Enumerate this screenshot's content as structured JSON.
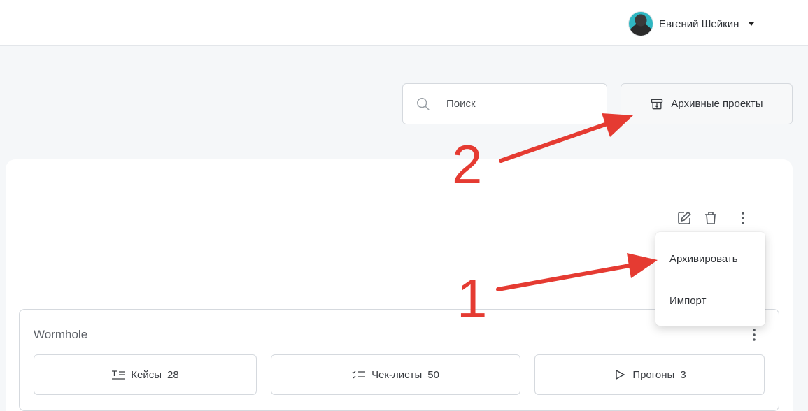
{
  "header": {
    "user_name": "Евгений Шейкин"
  },
  "toolbar": {
    "search_placeholder": "Поиск",
    "archive_projects_label": "Архивные проекты"
  },
  "context_menu": {
    "items": [
      {
        "label": "Архивировать"
      },
      {
        "label": "Импорт"
      }
    ]
  },
  "project": {
    "title": "Wormhole",
    "stats": [
      {
        "label": "Кейсы",
        "count": "28",
        "icon": "test-cases-icon"
      },
      {
        "label": "Чек-листы",
        "count": "50",
        "icon": "checklist-icon"
      },
      {
        "label": "Прогоны",
        "count": "3",
        "icon": "play-icon"
      }
    ]
  },
  "annotations": {
    "step_1": "1",
    "step_2": "2"
  },
  "colors": {
    "annotation": "#e53b32",
    "background": "#f5f7f9",
    "border": "#d5d9de"
  }
}
